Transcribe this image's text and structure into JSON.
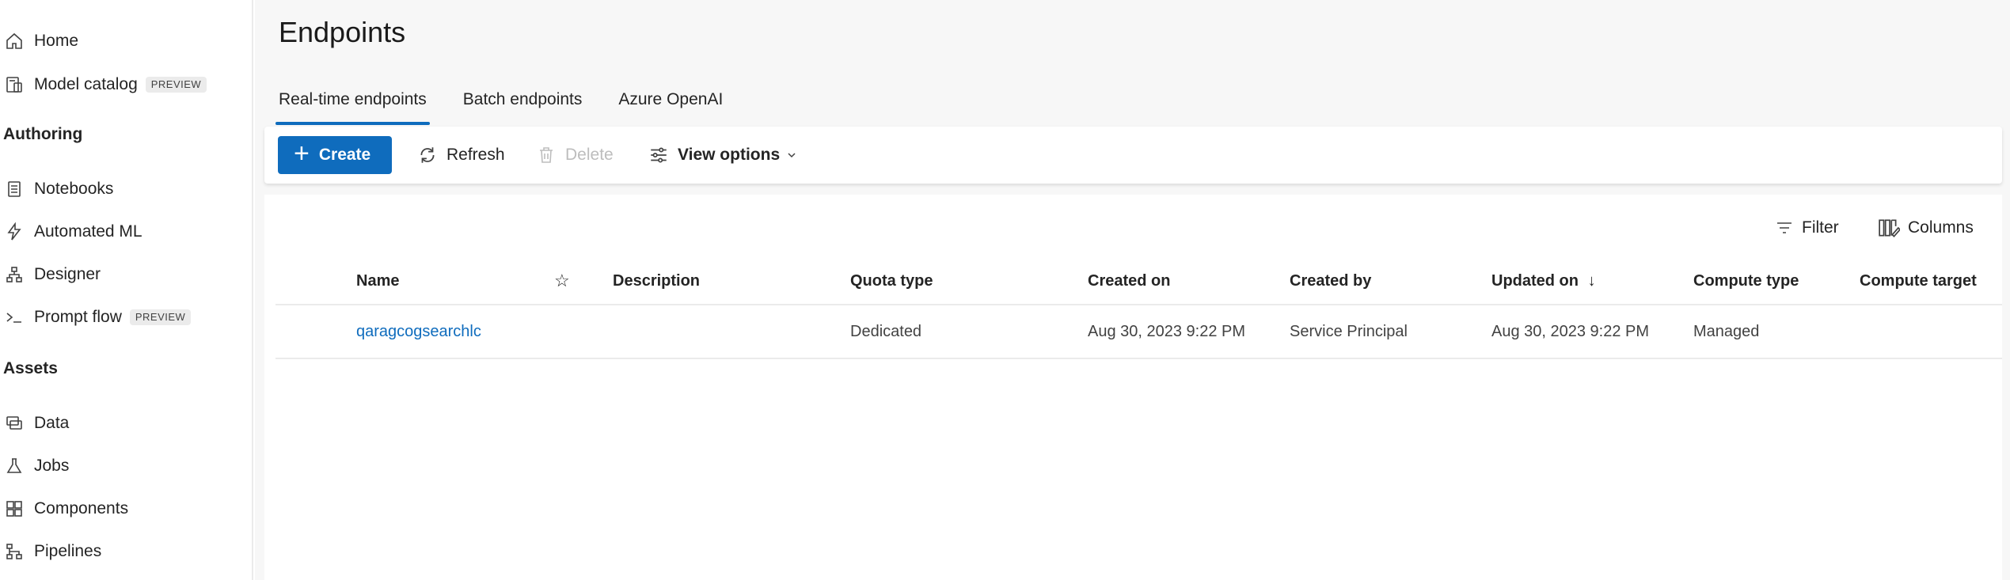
{
  "sidebar": {
    "items_top": [
      {
        "label": "Home",
        "icon": "home-icon"
      },
      {
        "label": "Model catalog",
        "badge": "PREVIEW",
        "icon": "model-catalog-icon"
      }
    ],
    "authoring_title": "Authoring",
    "authoring_items": [
      {
        "label": "Notebooks",
        "icon": "notebook-icon"
      },
      {
        "label": "Automated ML",
        "icon": "automated-ml-icon"
      },
      {
        "label": "Designer",
        "icon": "designer-icon"
      },
      {
        "label": "Prompt flow",
        "badge": "PREVIEW",
        "icon": "prompt-flow-icon"
      }
    ],
    "assets_title": "Assets",
    "assets_items": [
      {
        "label": "Data",
        "icon": "data-icon"
      },
      {
        "label": "Jobs",
        "icon": "jobs-icon"
      },
      {
        "label": "Components",
        "icon": "components-icon"
      },
      {
        "label": "Pipelines",
        "icon": "pipelines-icon"
      }
    ]
  },
  "page": {
    "title": "Endpoints",
    "tabs": [
      {
        "label": "Real-time endpoints",
        "active": true
      },
      {
        "label": "Batch endpoints",
        "active": false
      },
      {
        "label": "Azure OpenAI",
        "active": false
      }
    ]
  },
  "toolbar": {
    "create_label": "Create",
    "refresh_label": "Refresh",
    "delete_label": "Delete",
    "view_options_label": "View options"
  },
  "table_tools": {
    "filter_label": "Filter",
    "columns_label": "Columns"
  },
  "table": {
    "headers": {
      "name": "Name",
      "description": "Description",
      "quota_type": "Quota type",
      "created_on": "Created on",
      "created_by": "Created by",
      "updated_on": "Updated on",
      "compute_type": "Compute type",
      "compute_target": "Compute target"
    },
    "sort_indicator": "↓",
    "favorite_glyph": "☆",
    "rows": [
      {
        "name": "qaragcogsearchlc",
        "description": "",
        "quota_type": "Dedicated",
        "created_on": "Aug 30, 2023 9:22 PM",
        "created_by": "Service Principal",
        "updated_on": "Aug 30, 2023 9:22 PM",
        "compute_type": "Managed",
        "compute_target": ""
      }
    ]
  },
  "colors": {
    "accent": "#0f6cbd",
    "disabled": "#bdbdbd",
    "main_bg": "#f7f7f7"
  }
}
